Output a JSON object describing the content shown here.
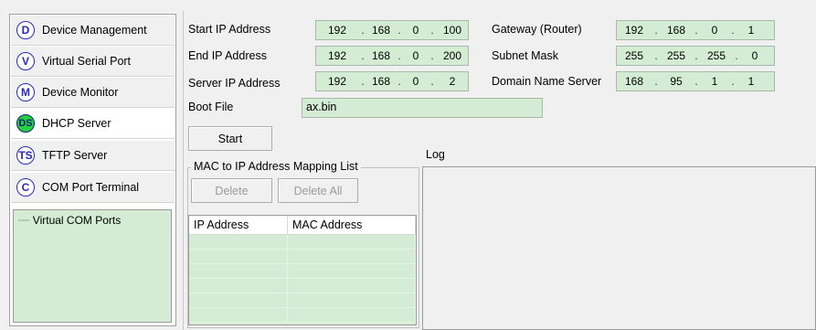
{
  "nav": {
    "items": [
      {
        "badge": "D",
        "label": "Device Management"
      },
      {
        "badge": "V",
        "label": "Virtual Serial Port"
      },
      {
        "badge": "M",
        "label": "Device Monitor"
      },
      {
        "badge": "DS",
        "label": "DHCP Server"
      },
      {
        "badge": "TS",
        "label": "TFTP Server"
      },
      {
        "badge": "C",
        "label": "COM Port Terminal"
      }
    ],
    "active_item": "DHCP Server",
    "tree_root": "Virtual COM Ports"
  },
  "dhcp": {
    "start_ip": {
      "label": "Start IP Address",
      "octets": [
        "192",
        "168",
        "0",
        "100"
      ]
    },
    "end_ip": {
      "label": "End IP Address",
      "octets": [
        "192",
        "168",
        "0",
        "200"
      ]
    },
    "server_ip": {
      "label": "Server IP Address",
      "octets": [
        "192",
        "168",
        "0",
        "2"
      ]
    },
    "gateway": {
      "label": "Gateway (Router)",
      "octets": [
        "192",
        "168",
        "0",
        "1"
      ]
    },
    "subnet": {
      "label": "Subnet Mask",
      "octets": [
        "255",
        "255",
        "255",
        "0"
      ]
    },
    "dns": {
      "label": "Domain Name Server",
      "octets": [
        "168",
        "95",
        "1",
        "1"
      ]
    },
    "boot_file": {
      "label": "Boot File",
      "value": "ax.bin"
    },
    "start_button": "Start"
  },
  "mapping": {
    "title": "MAC to IP Address Mapping List",
    "delete_button": "Delete",
    "delete_all_button": "Delete All",
    "columns": [
      "IP Address",
      "MAC Address"
    ],
    "rows": []
  },
  "log": {
    "title": "Log",
    "content": ""
  },
  "colors": {
    "field_bg": "#d3ecd3",
    "badge_blue": "#2a2ab8",
    "badge_active": "#22d040"
  },
  "icons": {
    "tree_connector": "dotted-line",
    "nav_badge": "circle-letter-badge"
  }
}
